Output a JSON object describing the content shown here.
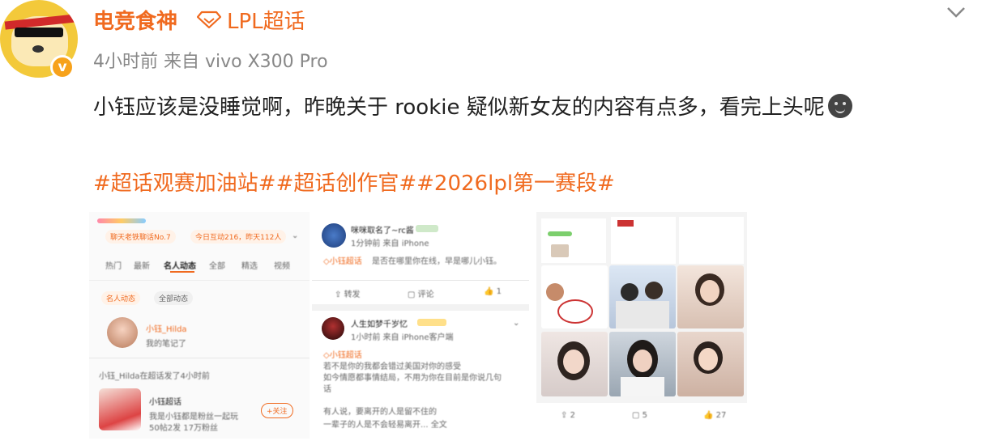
{
  "post": {
    "username": "电竞食神",
    "super_topic": "LPL超话",
    "meta": "4小时前  来自 vivo X300 Pro",
    "text": "小钰应该是没睡觉啊，昨晚关于 rookie 疑似新女友的内容有点多，看完上头呢",
    "emoji_icon": "smile-emoji-icon",
    "hashtags": "#超话观赛加油站##超话创作官##2026lpl第一赛段#",
    "verified_badge": "v",
    "accent_color": "#f06a1f"
  },
  "panel1": {
    "rank_a": "聊天老铁聊话No.7",
    "rank_b": "今日互动216，昨天112人",
    "tabs": [
      "热门",
      "最新",
      "名人动态",
      "全部",
      "精选",
      "视频"
    ],
    "filters": [
      "名人动态",
      "全部动态"
    ],
    "user1_name": "小钰_Hilda",
    "user1_sub": "我的笔记了",
    "notice": "小钰_Hilda在超话发了4小时前",
    "topic_name": "小钰超话",
    "topic_desc": "我是小钰都是粉丝一起玩",
    "topic_stats": "50帖2发  17万粉丝",
    "follow_btn": "+关注"
  },
  "panel2": {
    "user1": "咪咪取名了~rc酱",
    "user1_time": "1分钟前 来自 iPhone",
    "topic_tag": "◇小钰超话",
    "post1": "是否在哪里你在线，早是哪儿小钰。",
    "repost": "转发",
    "comment": "评论",
    "like_count": "1",
    "user2": "人生如梦千岁忆",
    "user2_time": "1小时前  来自 iPhone客户端",
    "post2_l1": "若不是你的我都会错过美国对你的感受",
    "post2_l2": "如今情愿都事情结局，不用为你在目前是你说几句",
    "post2_l3": "话",
    "post2_l4": "有人说，要离开的人是留不住的",
    "post2_l5": "一辈子的人是不会轻易离开... 全文"
  },
  "panel3": {
    "repost_count": "2",
    "comment_count": "5",
    "like_count": "27"
  }
}
